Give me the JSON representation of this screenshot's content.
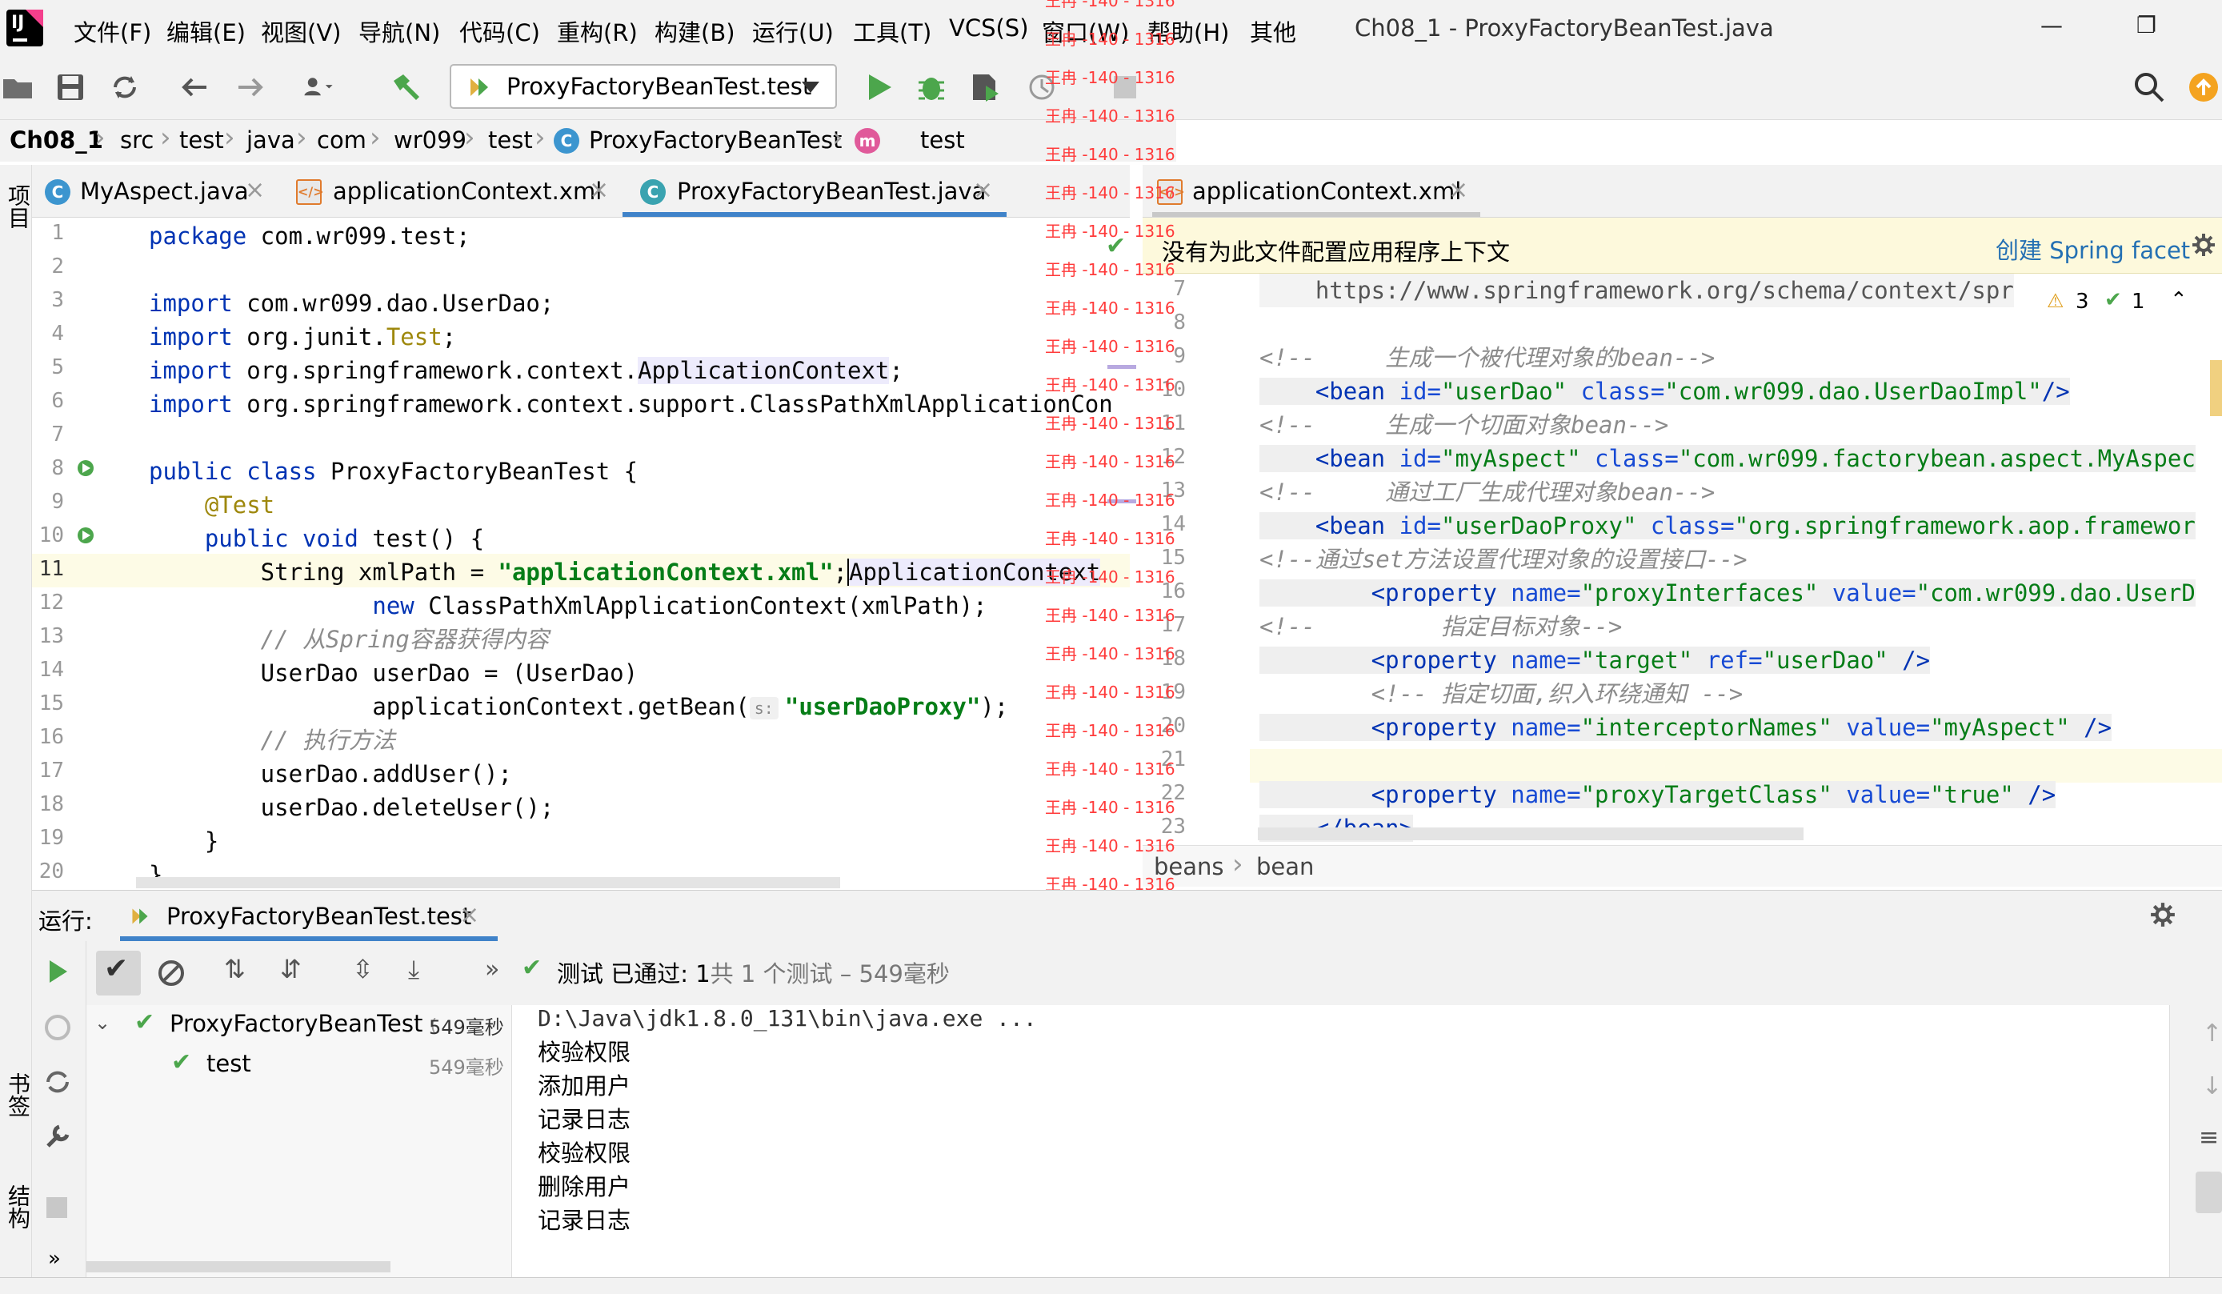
{
  "menu": [
    "文件(F)",
    "编辑(E)",
    "视图(V)",
    "导航(N)",
    "代码(C)",
    "重构(R)",
    "构建(B)",
    "运行(U)",
    "工具(T)",
    "VCS(S)",
    "窗口(W)",
    "帮助(H)",
    "其他"
  ],
  "window_title": "Ch08_1 - ProxyFactoryBeanTest.java",
  "window_buttons": {
    "minimize": "—",
    "restore": "❐"
  },
  "run_config": "ProxyFactoryBeanTest.test",
  "breadcrumb": [
    "Ch08_1",
    "src",
    "test",
    "java",
    "com",
    "wr099",
    "test",
    "ProxyFactoryBeanTest",
    "test"
  ],
  "tabs_left": [
    {
      "label": "MyAspect.java",
      "icon": "C"
    },
    {
      "label": "applicationContext.xml",
      "icon": "xml"
    },
    {
      "label": "ProxyFactoryBeanTest.java",
      "icon": "C"
    }
  ],
  "tabs_right": [
    {
      "label": "applicationContext.xml"
    }
  ],
  "tab_close": "×",
  "left_strip": {
    "project": "项目",
    "bookmarks": "书签",
    "structure": "结构"
  },
  "editor_left": {
    "line_numbers": [
      "1",
      "2",
      "3",
      "4",
      "5",
      "6",
      "7",
      "8",
      "9",
      "10",
      "11",
      "12",
      "13",
      "14",
      "15",
      "16",
      "17",
      "18",
      "19",
      "20"
    ],
    "code": {
      "l1a": "package",
      "l1b": " com.wr099.test;",
      "l3a": "import",
      "l3b": " com.wr099.dao.UserDao;",
      "l4a": "import",
      "l4b": " org.junit.",
      "l4c": "Test",
      "l4d": ";",
      "l5a": "import",
      "l5b": " org.springframework.context.",
      "l5c": "ApplicationContext",
      "l5d": ";",
      "l6a": "import",
      "l6b": " org.springframework.context.support.ClassPathXmlApplicationCon",
      "l8a": "public class",
      "l8b": " ProxyFactoryBeanTest {",
      "l9": "    @Test",
      "l10a": "    public void",
      "l10b": " test() {",
      "l11a": "        String xmlPath = ",
      "l11b": "\"applicationContext.xml\"",
      "l11c": ";",
      "l11d": "ApplicationContext",
      "l12a": "                ",
      "l12b": "new",
      "l12c": " ClassPathXmlApplicationContext(xmlPath);",
      "l13": "        // 从Spring容器获得内容",
      "l14": "        UserDao userDao = (UserDao)",
      "l15a": "                applicationContext.getBean(",
      "l15hint": "s:",
      "l15b": "\"userDaoProxy\"",
      "l15c": ");",
      "l16": "        // 执行方法",
      "l17": "        userDao.addUser();",
      "l18": "        userDao.deleteUser();",
      "l19": "    }",
      "l20": "}"
    }
  },
  "watermark": "王冉 -140 - 1316",
  "editor_right": {
    "banner_text": "没有为此文件配置应用程序上下文",
    "banner_link": "创建 Spring facet",
    "inspection": {
      "warnings": "3",
      "ok": "1"
    },
    "line_numbers": [
      "7",
      "8",
      "9",
      "10",
      "11",
      "12",
      "13",
      "14",
      "15",
      "16",
      "17",
      "18",
      "19",
      "20",
      "21",
      "22",
      "23"
    ],
    "code": {
      "r7": "    https://www.springframework.org/schema/context/spr",
      "r9": "<!--     生成一个被代理对象的bean-->",
      "r10a": "    <bean",
      "r10b": " id=",
      "r10c": "\"userDao\"",
      "r10d": " class=",
      "r10e": "\"com.wr099.dao.UserDaoImpl\"",
      "r10f": "/>",
      "r11": "<!--     生成一个切面对象bean-->",
      "r12a": "    <bean",
      "r12b": " id=",
      "r12c": "\"myAspect\"",
      "r12d": " class=",
      "r12e": "\"com.wr099.factorybean.aspect.MyAspec",
      "r13": "<!--     通过工厂生成代理对象bean-->",
      "r14a": "    <bean",
      "r14b": " id=",
      "r14c": "\"userDaoProxy\"",
      "r14d": " class=",
      "r14e": "\"org.springframework.aop.framewor",
      "r15": "<!--通过set方法设置代理对象的设置接口-->",
      "r16a": "        <property",
      "r16b": " name=",
      "r16c": "\"proxyInterfaces\"",
      "r16d": " value=",
      "r16e": "\"com.wr099.dao.UserD",
      "r17": "<!--         指定目标对象-->",
      "r18a": "        <property",
      "r18b": " name=",
      "r18c": "\"target\"",
      "r18d": " ref=",
      "r18e": "\"userDao\"",
      "r18f": " />",
      "r19": "        <!-- 指定切面,织入环绕通知 -->",
      "r20a": "        <property",
      "r20b": " name=",
      "r20c": "\"interceptorNames\"",
      "r20d": " value=",
      "r20e": "\"myAspect\"",
      "r20f": " />",
      "r22a": "        <property",
      "r22b": " name=",
      "r22c": "\"proxyTargetClass\"",
      "r22d": " value=",
      "r22e": "\"true\"",
      "r22f": " />",
      "r23": "    </bean>"
    },
    "crumb": [
      "beans",
      "bean"
    ]
  },
  "run_panel": {
    "label": "运行:",
    "tab": "ProxyFactoryBeanTest.test",
    "status_prefix": "测试 已通过: 1",
    "status_suffix": "共 1 个测试 – 549毫秒",
    "tree": [
      {
        "name": "ProxyFactoryBeanTest",
        "hint": "(",
        "time": "549毫秒"
      },
      {
        "name": "test",
        "time": "549毫秒"
      }
    ],
    "console": [
      "D:\\Java\\jdk1.8.0_131\\bin\\java.exe ...",
      "校验权限",
      "添加用户",
      "记录日志",
      "校验权限",
      "删除用户",
      "记录日志"
    ]
  },
  "colors": {
    "accent": "#4083c9",
    "keyword": "#0033b3",
    "string": "#067d17",
    "annotation": "#9e880d",
    "comment": "#8c8c8c",
    "watermark": "#ff3b3b",
    "pass": "#4ca64c"
  }
}
